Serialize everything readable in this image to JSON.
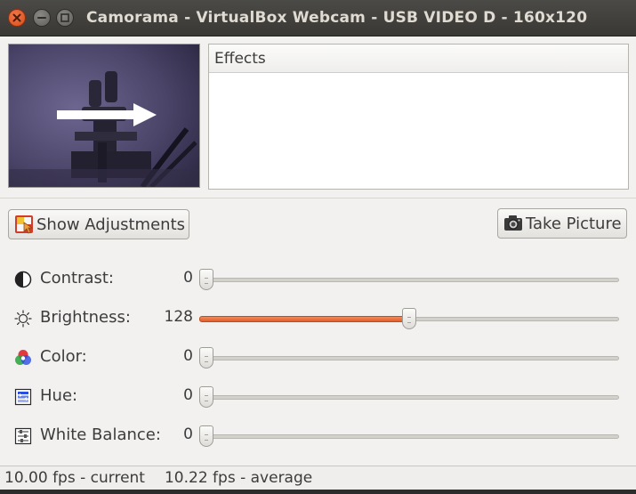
{
  "window": {
    "title": "Camorama - VirtualBox Webcam - USB VIDEO D - 160x120"
  },
  "effects": {
    "header": "Effects"
  },
  "buttons": {
    "show_adjustments": "Show Adjustments",
    "take_picture": "Take Picture"
  },
  "adjustments": [
    {
      "label": "Contrast:",
      "value": "0",
      "level": 0.0,
      "icon": "contrast-icon"
    },
    {
      "label": "Brightness:",
      "value": "128",
      "level": 0.5,
      "icon": "brightness-icon"
    },
    {
      "label": "Color:",
      "value": "0",
      "level": 0.0,
      "icon": "color-icon"
    },
    {
      "label": "Hue:",
      "value": "0",
      "level": 0.0,
      "icon": "hue-icon"
    },
    {
      "label": "White Balance:",
      "value": "0",
      "level": 0.0,
      "icon": "white-balance-icon"
    }
  ],
  "status": {
    "current": "10.00 fps - current",
    "average": "10.22 fps - average"
  },
  "colors": {
    "slider_fill": "#e8683a",
    "close_button": "#e25a25",
    "titlebar": "#3f3e3a"
  }
}
